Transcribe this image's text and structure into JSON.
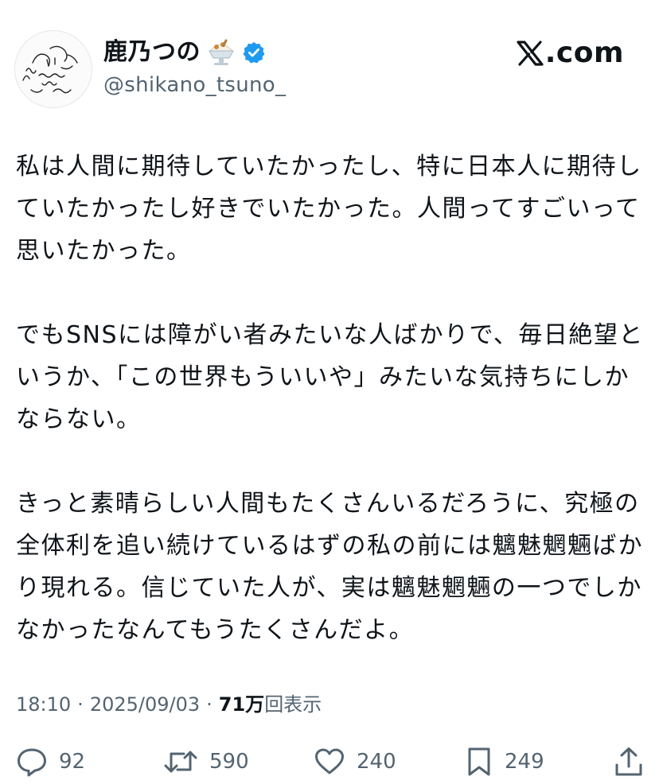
{
  "author": {
    "display_name": "鹿乃つの",
    "handle": "@shikano_tsuno_",
    "emoji_icon": "shaved-ice-emoji-icon",
    "verified_icon": "verified-badge-icon",
    "verified_color": "#1d9bf0"
  },
  "source": {
    "logo_icon": "x-logo-icon",
    "domain_text": ".com"
  },
  "tweet": {
    "paragraphs": [
      "私は人間に期待していたかったし、特に日本人に期待していたかったし好きでいたかった。人間ってすごいって思いたかった。",
      "でもSNSには障がい者みたいな人ばかりで、毎日絶望というか、「この世界もういいや」みたいな気持ちにしかならない。",
      "きっと素晴らしい人間もたくさんいるだろうに、究極の全体利を追い続けているはずの私の前には魑魅魍魎ばかり現れる。信じていた人が、実は魑魅魍魎の一つでしかなかったなんてもうたくさんだよ。"
    ]
  },
  "meta": {
    "time": "18:10",
    "separator": "·",
    "date": "2025/09/03",
    "views_count": "71万",
    "views_label": "回表示"
  },
  "actions": {
    "reply": {
      "icon": "reply-icon",
      "count": "92"
    },
    "retweet": {
      "icon": "retweet-icon",
      "count": "590"
    },
    "like": {
      "icon": "heart-icon",
      "count": "240"
    },
    "bookmark": {
      "icon": "bookmark-icon",
      "count": "249"
    },
    "share": {
      "icon": "share-icon"
    }
  },
  "colors": {
    "text_primary": "#0f1419",
    "text_secondary": "#536471",
    "background": "#ffffff"
  }
}
